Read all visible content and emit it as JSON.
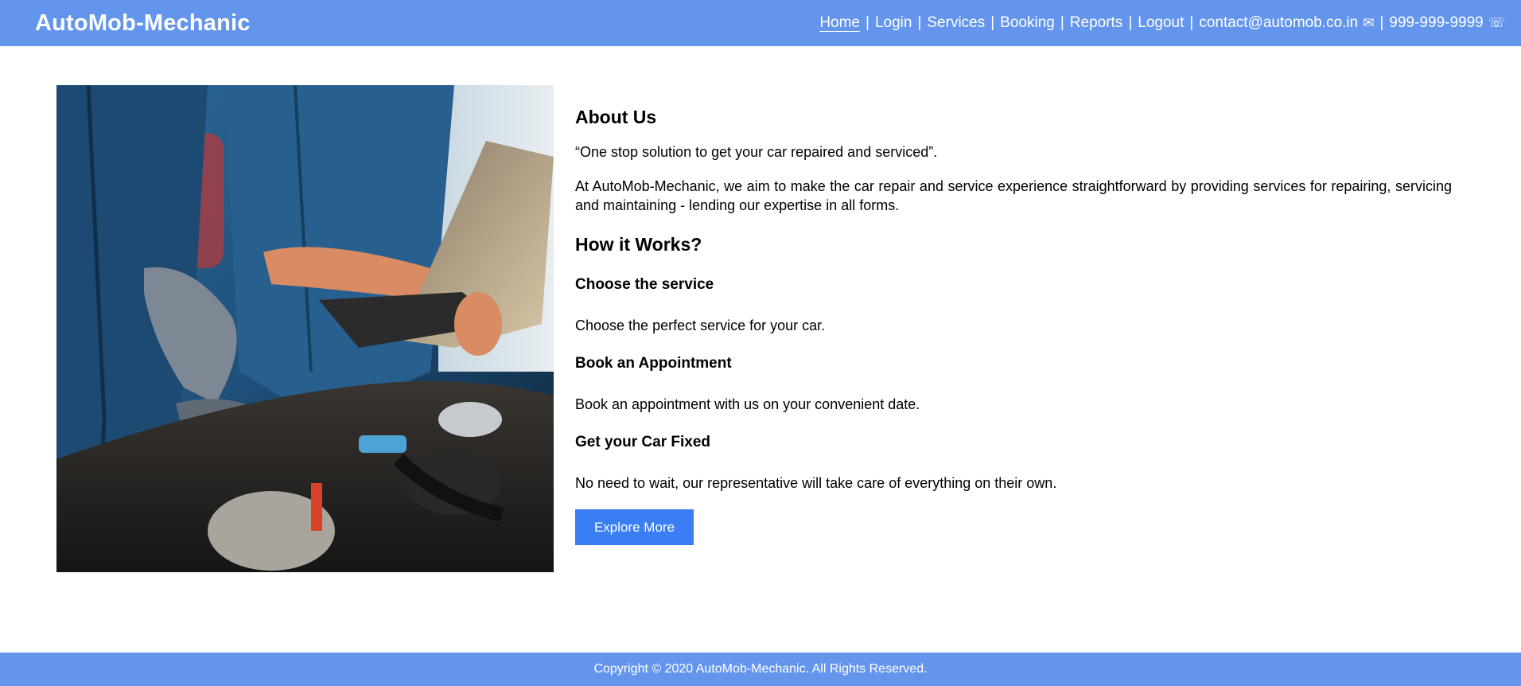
{
  "header": {
    "brand": "AutoMob-Mechanic",
    "nav": [
      {
        "label": "Home",
        "active": true
      },
      {
        "label": "Login"
      },
      {
        "label": "Services"
      },
      {
        "label": "Booking"
      },
      {
        "label": "Reports"
      },
      {
        "label": "Logout"
      }
    ],
    "separator": "|",
    "email": "contact@automob.co.in",
    "email_icon": "✉",
    "phone": "999-999-9999",
    "phone_icon": "☏"
  },
  "about": {
    "heading": "About Us",
    "quote": "“One stop solution to get your car repaired and serviced”.",
    "description": "At AutoMob-Mechanic, we aim to make the car repair and service experience straightforward by providing services for repairing, servicing and maintaining - lending our expertise in all forms."
  },
  "how": {
    "heading": "How it Works?",
    "steps": [
      {
        "title": "Choose the service",
        "text": "Choose the perfect service for your car."
      },
      {
        "title": "Book an Appointment",
        "text": "Book an appointment with us on your convenient date."
      },
      {
        "title": "Get your Car Fixed",
        "text": "No need to wait, our representative will take care of everything on their own."
      }
    ]
  },
  "cta": {
    "label": "Explore More"
  },
  "footer": {
    "text": "Copyright © 2020 AutoMob-Mechanic.  All Rights Reserved."
  },
  "colors": {
    "header_bg": "#6495ed",
    "button_bg": "#3b7df3"
  }
}
